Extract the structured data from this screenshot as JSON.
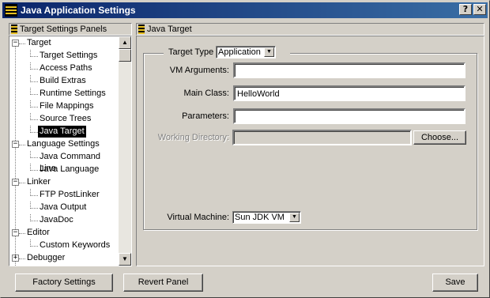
{
  "window": {
    "title": "Java Application Settings",
    "help_label": "?",
    "close_label": "✕"
  },
  "left_panel": {
    "header": "Target Settings Panels",
    "tree": [
      {
        "label": "Target",
        "level": 0,
        "expander": "−"
      },
      {
        "label": "Target Settings",
        "level": 1
      },
      {
        "label": "Access Paths",
        "level": 1
      },
      {
        "label": "Build Extras",
        "level": 1
      },
      {
        "label": "Runtime Settings",
        "level": 1
      },
      {
        "label": "File Mappings",
        "level": 1
      },
      {
        "label": "Source Trees",
        "level": 1
      },
      {
        "label": "Java Target",
        "level": 1,
        "selected": true
      },
      {
        "label": "Language Settings",
        "level": 0,
        "expander": "−"
      },
      {
        "label": "Java Command Line",
        "level": 1
      },
      {
        "label": "Java Language",
        "level": 1
      },
      {
        "label": "Linker",
        "level": 0,
        "expander": "−"
      },
      {
        "label": "FTP PostLinker",
        "level": 1
      },
      {
        "label": "Java Output",
        "level": 1
      },
      {
        "label": "JavaDoc",
        "level": 1
      },
      {
        "label": "Editor",
        "level": 0,
        "expander": "−"
      },
      {
        "label": "Custom Keywords",
        "level": 1
      },
      {
        "label": "Debugger",
        "level": 0,
        "expander": "+"
      }
    ],
    "scroll_up": "▲",
    "scroll_down": "▼"
  },
  "right_panel": {
    "header": "Java Target",
    "target_type": {
      "label": "Target Type",
      "value": "Application"
    },
    "vm_arguments": {
      "label": "VM Arguments:",
      "value": ""
    },
    "main_class": {
      "label": "Main Class:",
      "value": "HelloWorld"
    },
    "parameters": {
      "label": "Parameters:",
      "value": ""
    },
    "working_directory": {
      "label": "Working Directory:",
      "value": "",
      "button": "Choose..."
    },
    "virtual_machine": {
      "label": "Virtual Machine:",
      "value": "Sun JDK VM"
    },
    "dropdown_arrow": "▼"
  },
  "footer": {
    "factory_settings": "Factory Settings",
    "revert_panel": "Revert Panel",
    "save": "Save"
  },
  "colors": {
    "title_bar": "#0a246a",
    "selection": "#000000",
    "window_bg": "#d4d0c8"
  }
}
